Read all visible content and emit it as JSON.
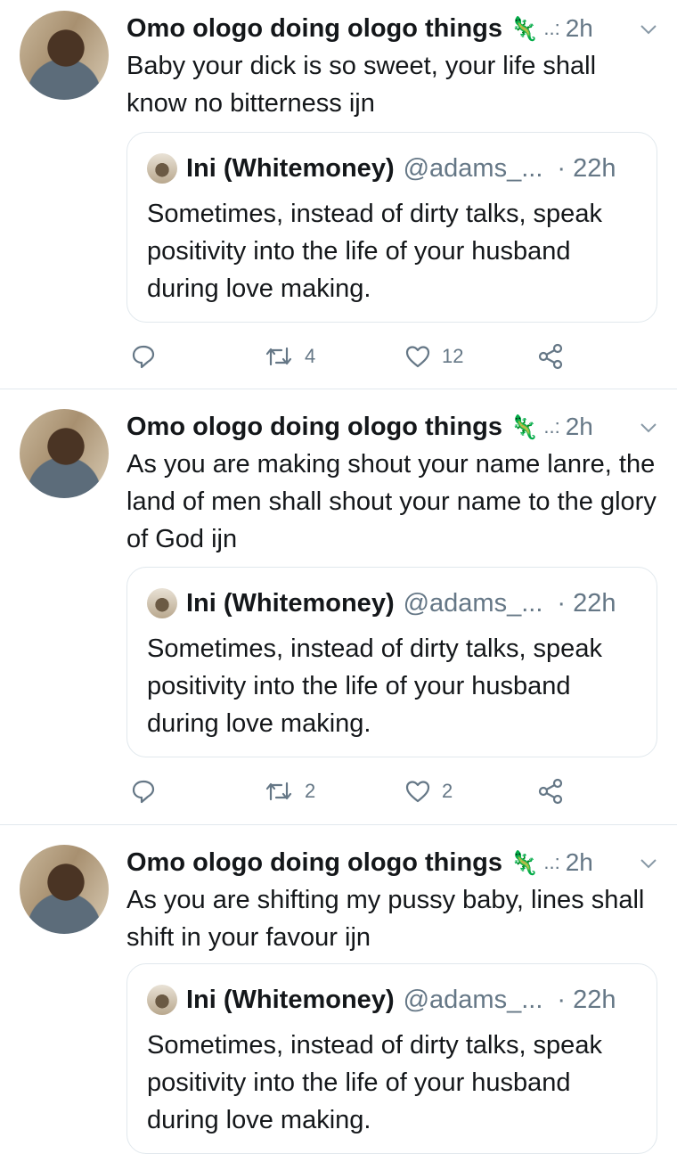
{
  "tweets": [
    {
      "name": "Omo ologo doing ologo things",
      "badge": "🦎",
      "dots": "..:",
      "time": "2h",
      "text": "Baby your dick is so sweet, your life shall know no bitterness ijn",
      "quote": {
        "name": "Ini (Whitemoney)",
        "handle": "@adams_...",
        "time": "· 22h",
        "text": "Sometimes, instead of dirty talks, speak positivity into the life of your husband during love making."
      },
      "retweets": "4",
      "likes": "12"
    },
    {
      "name": "Omo ologo doing ologo things",
      "badge": "🦎",
      "dots": "..:",
      "time": "2h",
      "text": "As you are making shout your name lanre, the land of men shall shout your name to the glory of God ijn",
      "quote": {
        "name": "Ini (Whitemoney)",
        "handle": "@adams_...",
        "time": "· 22h",
        "text": "Sometimes, instead of dirty talks, speak positivity into the life of your husband during love making."
      },
      "retweets": "2",
      "likes": "2"
    },
    {
      "name": "Omo ologo doing ologo things",
      "badge": "🦎",
      "dots": "..:",
      "time": "2h",
      "text": "As you are shifting my pussy baby, lines shall shift in your favour ijn",
      "quote": {
        "name": "Ini (Whitemoney)",
        "handle": "@adams_...",
        "time": "· 22h",
        "text": "Sometimes, instead of dirty talks, speak positivity into the life of your husband during love making."
      }
    }
  ],
  "icons": {
    "reply": "reply-icon",
    "retweet": "retweet-icon",
    "like": "heart-icon",
    "share": "share-icon",
    "menu": "chevron-down-icon"
  },
  "colors": {
    "secondary_text": "#657786",
    "border": "#e1e8ed",
    "text": "#14171a"
  }
}
